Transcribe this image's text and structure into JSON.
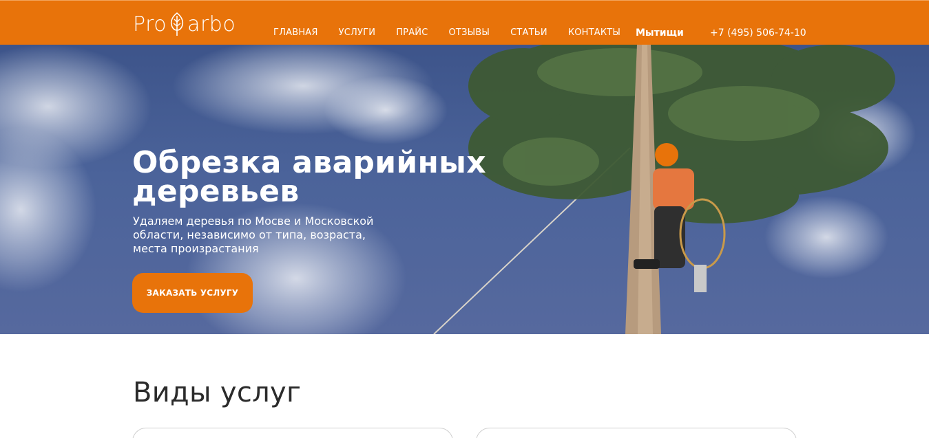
{
  "header": {
    "logo": {
      "text_left": "Pro",
      "text_right": "arbo"
    },
    "nav": [
      {
        "label": "ГЛАВНАЯ"
      },
      {
        "label": "УСЛУГИ"
      },
      {
        "label": "ПРАЙС"
      },
      {
        "label": "ОТЗЫВЫ"
      },
      {
        "label": "СТАТЬИ"
      },
      {
        "label": "КОНТАКТЫ"
      }
    ],
    "city": "Мытищи",
    "phone": "+7 (495) 506-74-10"
  },
  "hero": {
    "title_line1": "Обрезка аварийных",
    "title_line2": "деревьев",
    "subtitle_line1": "Удаляем деревья по Мосве и Московской",
    "subtitle_line2": "области, независимо от типа, возраста,",
    "subtitle_line3": "места произрастания",
    "cta_label": "ЗАКАЗАТЬ УСЛУГУ"
  },
  "services": {
    "title": "Виды услуг"
  },
  "colors": {
    "accent": "#e8730a",
    "sky": "#4b639a",
    "white": "#ffffff",
    "text_dark": "#2b2b2b"
  },
  "icons": [
    "leaf-icon"
  ]
}
